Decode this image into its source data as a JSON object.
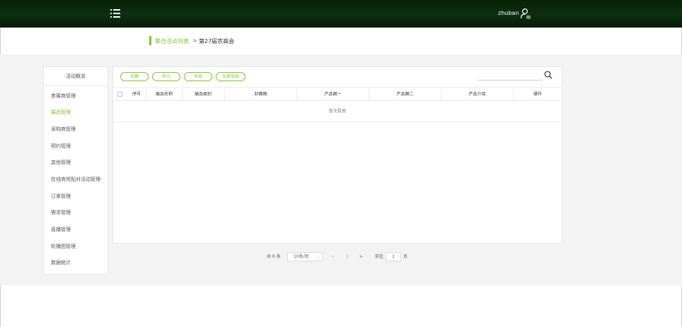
{
  "header": {
    "username": "zhuban",
    "menu_icon": "list-menu-icon",
    "user_icon": "user-settings-icon"
  },
  "breadcrumb": {
    "parent": "聚合活动列表",
    "separator": ">",
    "current": "第27届农高会"
  },
  "sidebar": {
    "title": "活动概览",
    "items": [
      {
        "label": "参展商管理",
        "active": false
      },
      {
        "label": "展品管理",
        "active": true
      },
      {
        "label": "采购商管理",
        "active": false
      },
      {
        "label": "预约管理",
        "active": false
      },
      {
        "label": "其他管理",
        "active": false
      },
      {
        "label": "在线商贸配对活动管理",
        "active": false
      },
      {
        "label": "订单管理",
        "active": false
      },
      {
        "label": "需求管理",
        "active": false
      },
      {
        "label": "直播管理",
        "active": false
      },
      {
        "label": "轮播图管理",
        "active": false
      },
      {
        "label": "数据统计",
        "active": false
      }
    ]
  },
  "toolbar": {
    "create_label": "创建",
    "import_label": "导入",
    "export_label": "导出",
    "export_all_label": "全部导出",
    "search_placeholder": ""
  },
  "table": {
    "columns": [
      "序号",
      "展品名称",
      "展品类别",
      "封面图",
      "产品图一",
      "产品图二",
      "产品介绍",
      "操作"
    ],
    "empty_text": "暂无数据"
  },
  "pagination": {
    "total_text": "共 0 条",
    "page_size": "10条/页",
    "prev": "<",
    "current_page": "1",
    "next": ">",
    "goto_label": "前往",
    "goto_value": "1",
    "page_suffix": "页"
  },
  "colors": {
    "accent": "#7ec42d",
    "header_bg": "#0d2f10",
    "band_bg": "#f3f3f3"
  }
}
